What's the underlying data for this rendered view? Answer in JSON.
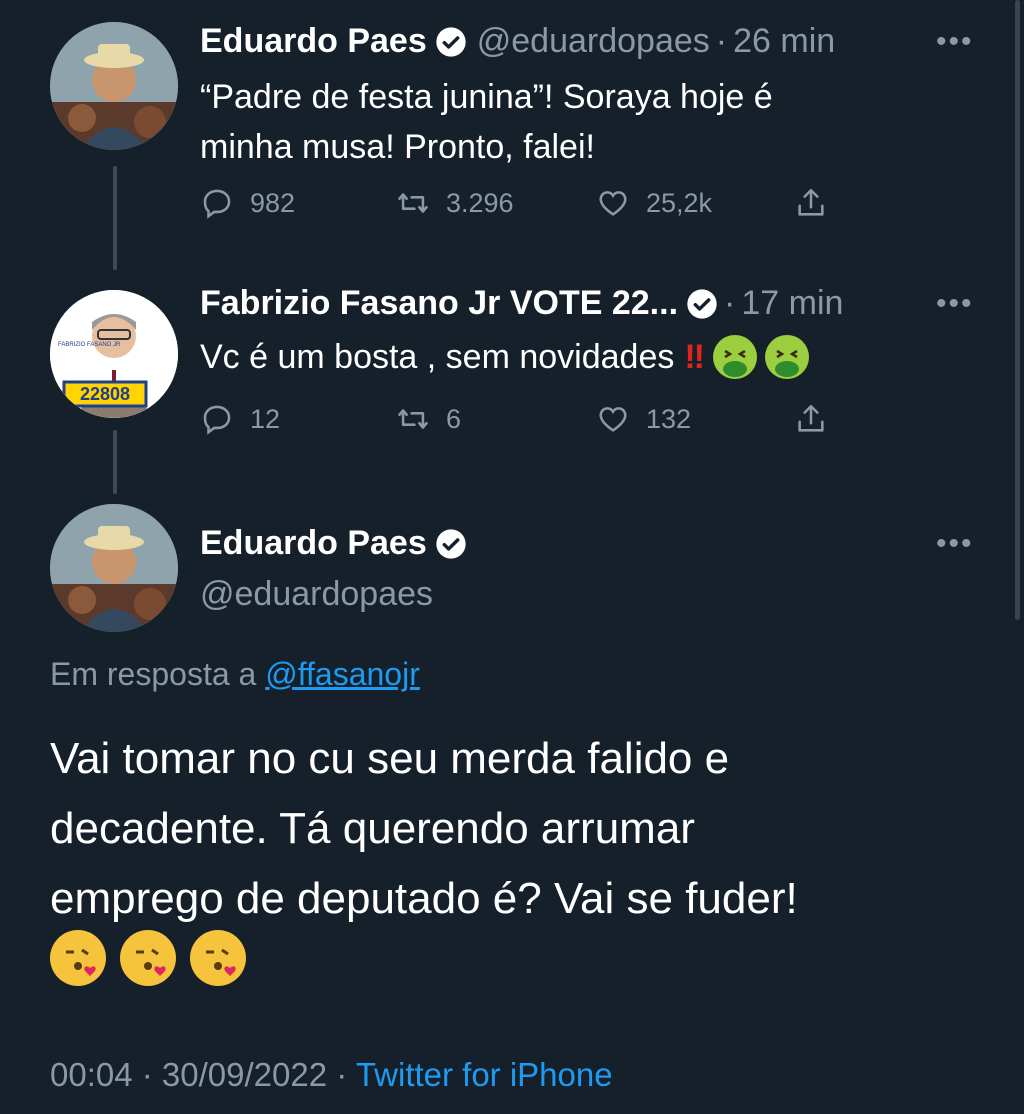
{
  "tweet1": {
    "name": "Eduardo Paes",
    "handle": "@eduardopaes",
    "time": "26 min",
    "text_line1": "“Padre de festa junina”!  Soraya hoje é",
    "text_line2": "minha musa!  Pronto, falei!",
    "replies": "982",
    "retweets": "3.296",
    "likes": "25,2k"
  },
  "tweet2": {
    "name": "Fabrizio Fasano Jr VOTE 22...",
    "time": "17 min",
    "text": "Vc é um bosta , sem novidades",
    "bang": "‼",
    "avatar_label": "22808",
    "avatar_small": "FABRIZIO FASANO JR",
    "replies": "12",
    "retweets": "6",
    "likes": "132"
  },
  "main": {
    "name": "Eduardo Paes",
    "handle": "@eduardopaes",
    "reply_prefix": "Em resposta a",
    "reply_handle": "@ffasanojr",
    "text_line1": "Vai tomar no cu seu merda falido e",
    "text_line2": "decadente.  Tá querendo arrumar",
    "text_line3": "emprego de deputado é?  Vai se fuder!",
    "timestamp": "00:04 · 30/09/2022 · ",
    "source": "Twitter for iPhone"
  },
  "colors": {
    "background": "#15202b",
    "muted": "#8b98a5",
    "link": "#1d9bf0"
  },
  "separator": "·",
  "more_label": "•••"
}
